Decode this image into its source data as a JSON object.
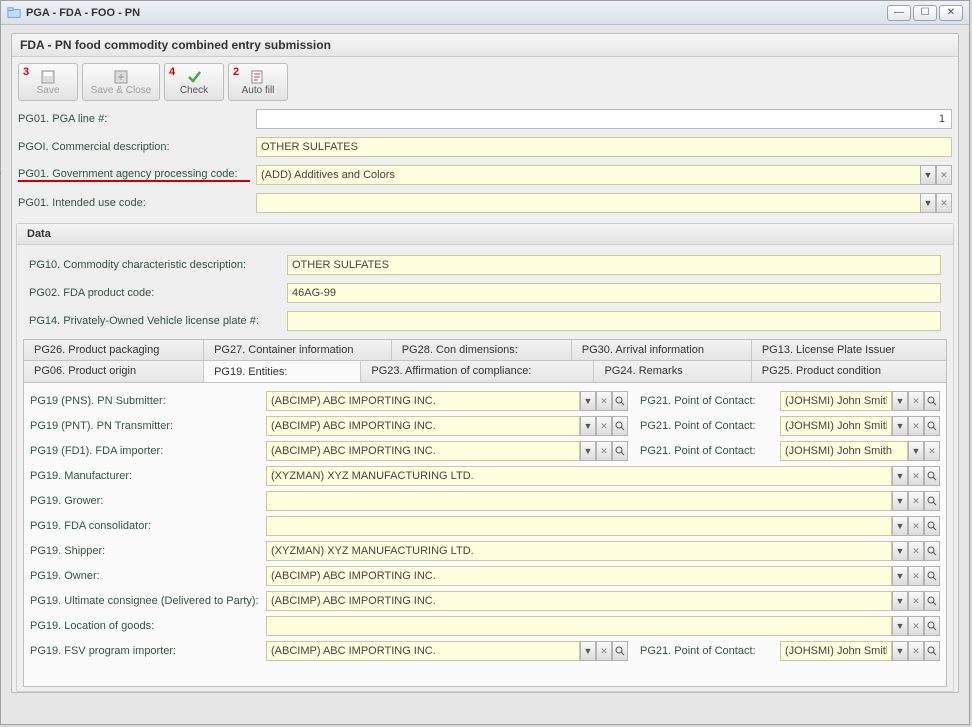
{
  "window": {
    "title": "PGA - FDA - FOO - PN"
  },
  "panel": {
    "title": "FDA - PN food commodity combined entry submission"
  },
  "toolbar": {
    "save": "Save",
    "save_close": "Save & Close",
    "check": "Check",
    "autofill": "Auto fill",
    "badge_save": "3",
    "badge_check": "4",
    "badge_autofill": "2"
  },
  "top": {
    "pga_line_label": "PG01. PGA line #:",
    "pga_line_value": "1",
    "comm_desc_label": "PGOI. Commercial description:",
    "comm_desc_value": "OTHER SULFATES",
    "gov_code_label": "PG01. Government agency processing code:",
    "gov_code_value": "(ADD) Additives and Colors",
    "intended_label": "PG01. Intended use code:",
    "intended_value": ""
  },
  "marker1": "1",
  "data_header": "Data",
  "data": {
    "pg10_label": "PG10. Commodity characteristic description:",
    "pg10_value": "OTHER SULFATES",
    "pg02_label": "PG02. FDA product code:",
    "pg02_value": "46AG-99",
    "pg14_label": "PG14.  Privately-Owned Vehicle license plate #:",
    "pg14_value": ""
  },
  "tabs_top": {
    "pg26": "PG26. Product packaging",
    "pg27": "PG27. Container information",
    "pg28": "PG28. Con dimensions:",
    "pg30": "PG30. Arrival information",
    "pg13": "PG13. License Plate Issuer"
  },
  "tabs_bottom": {
    "pg06": "PG06. Product origin",
    "pg19": "PG19. Entities:",
    "pg23": "PG23. Affirmation of compliance:",
    "pg24": "PG24. Remarks",
    "pg25": "PG25. Product condition"
  },
  "entities": {
    "poc_label": "PG21. Point of Contact:",
    "rows": [
      {
        "label": "PG19 (PNS). PN Submitter:",
        "val": "(ABCIMP) ABC IMPORTING INC.",
        "drop": true,
        "clear": true,
        "search": true,
        "poc": "(JOHSMI) John Smith",
        "poc_drop": true,
        "poc_clear": true,
        "poc_search": true,
        "has_poc": true
      },
      {
        "label": "PG19 (PNT). PN Transmitter:",
        "val": "(ABCIMP) ABC IMPORTING INC.",
        "drop": true,
        "clear": true,
        "search": true,
        "poc": "(JOHSMI) John Smith",
        "poc_drop": true,
        "poc_clear": true,
        "poc_search": true,
        "has_poc": true
      },
      {
        "label": "PG19 (FD1). FDA importer:",
        "val": "(ABCIMP) ABC IMPORTING INC.",
        "drop": true,
        "clear": true,
        "search": true,
        "poc": "(JOHSMI) John Smith",
        "poc_drop": true,
        "poc_clear": true,
        "poc_search": false,
        "has_poc": true
      },
      {
        "label": "PG19. Manufacturer:",
        "val": "(XYZMAN) XYZ MANUFACTURING LTD.",
        "drop": true,
        "clear": true,
        "search": true,
        "has_poc": false,
        "full": true
      },
      {
        "label": "PG19. Grower:",
        "val": "",
        "drop": true,
        "clear": true,
        "search": true,
        "has_poc": false,
        "full": true
      },
      {
        "label": "PG19. FDA consolidator:",
        "val": "",
        "drop": true,
        "clear": true,
        "search": true,
        "has_poc": false,
        "full": true
      },
      {
        "label": "PG19. Shipper:",
        "val": "(XYZMAN) XYZ MANUFACTURING LTD.",
        "drop": true,
        "clear": true,
        "search": true,
        "has_poc": false,
        "full": true
      },
      {
        "label": "PG19. Owner:",
        "val": "(ABCIMP) ABC IMPORTING INC.",
        "drop": true,
        "clear": true,
        "search": true,
        "has_poc": false,
        "full": true
      },
      {
        "label": "PG19. Ultimate consignee (Delivered to Party):",
        "val": "(ABCIMP) ABC IMPORTING INC.",
        "drop": true,
        "clear": true,
        "search": true,
        "has_poc": false,
        "full": true
      },
      {
        "label": "PG19. Location of goods:",
        "val": "",
        "drop": true,
        "clear": true,
        "search": true,
        "has_poc": false,
        "full": true
      },
      {
        "label": "PG19. FSV program importer:",
        "val": "(ABCIMP) ABC IMPORTING INC.",
        "drop": true,
        "clear": true,
        "search": true,
        "poc": "(JOHSMI) John Smith",
        "poc_drop": true,
        "poc_clear": true,
        "poc_search": true,
        "has_poc": true
      }
    ]
  }
}
